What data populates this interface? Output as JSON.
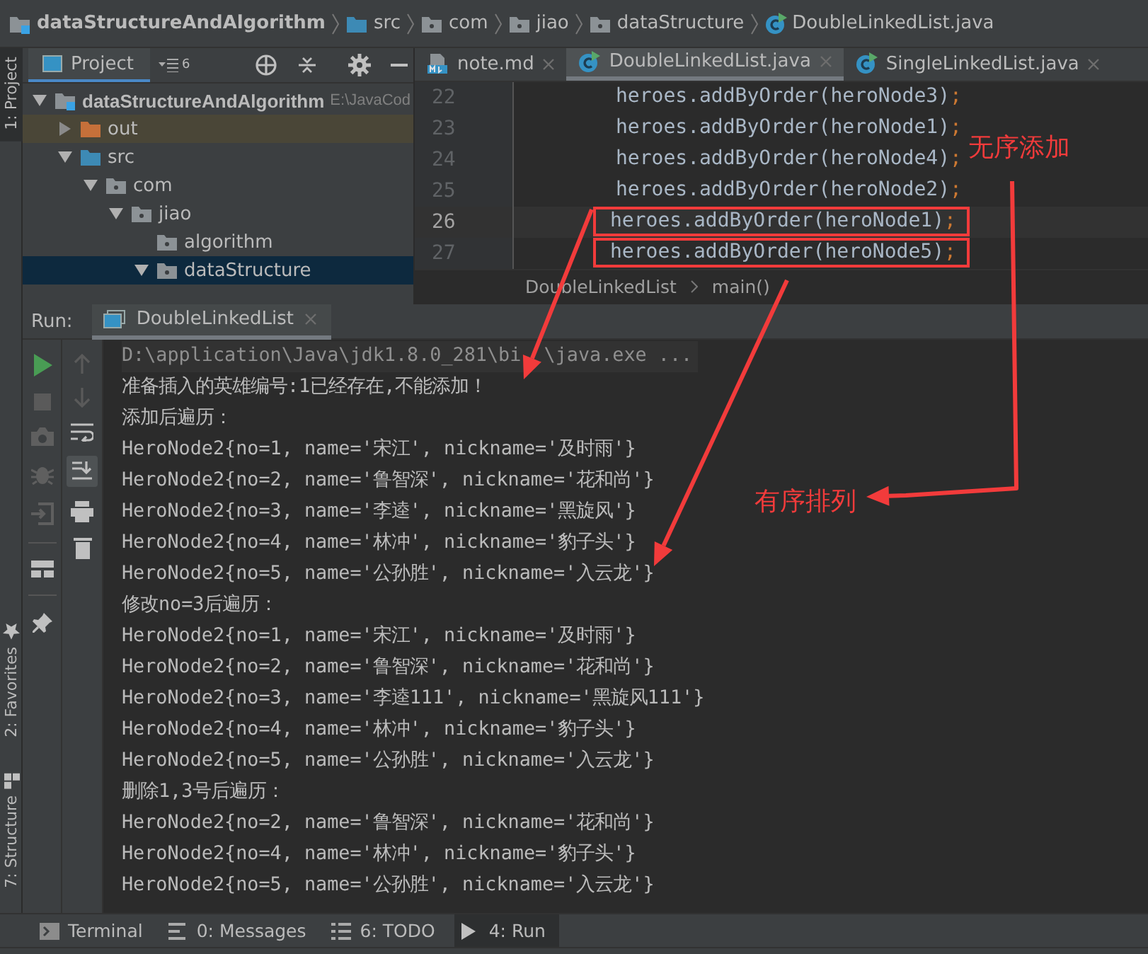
{
  "breadcrumbs": [
    {
      "label": "dataStructureAndAlgorithm",
      "kind": "module"
    },
    {
      "label": "src",
      "kind": "source"
    },
    {
      "label": "com",
      "kind": "package"
    },
    {
      "label": "jiao",
      "kind": "package"
    },
    {
      "label": "dataStructure",
      "kind": "package"
    },
    {
      "label": "DoubleLinkedList.java",
      "kind": "class"
    }
  ],
  "left_stripe": {
    "top": [
      {
        "label": "1: Project",
        "selected": true
      }
    ],
    "bottom": [
      {
        "label": "2: Favorites",
        "selected": false,
        "kind": "star"
      },
      {
        "label": "7: Structure",
        "selected": false,
        "kind": "structure"
      }
    ]
  },
  "project_panel": {
    "title": "Project",
    "count": "6",
    "tree": [
      {
        "label": "dataStructureAndAlgorithm",
        "path": "E:\\JavaCod",
        "kind": "module",
        "expanded": true,
        "selected": false,
        "children": [
          {
            "label": "out",
            "kind": "excluded",
            "expanded": false,
            "selected": false
          },
          {
            "label": "src",
            "kind": "source",
            "expanded": true,
            "selected": false,
            "children": [
              {
                "label": "com",
                "kind": "package",
                "expanded": true,
                "selected": false,
                "children": [
                  {
                    "label": "jiao",
                    "kind": "package",
                    "expanded": true,
                    "selected": false,
                    "children": [
                      {
                        "label": "algorithm",
                        "kind": "package",
                        "selected": false
                      },
                      {
                        "label": "dataStructure",
                        "kind": "package",
                        "expanded": true,
                        "selected": true
                      }
                    ]
                  }
                ]
              }
            ]
          }
        ]
      }
    ]
  },
  "editor": {
    "tabs": [
      {
        "label": "note.md",
        "kind": "markdown",
        "selected": false
      },
      {
        "label": "DoubleLinkedList.java",
        "kind": "class",
        "selected": true
      },
      {
        "label": "SingleLinkedList.java",
        "kind": "class",
        "selected": false
      }
    ],
    "lines": [
      {
        "number": "22",
        "code": "heroes.addByOrder(heroNode3)",
        "end": ";",
        "current": false,
        "boxed": false
      },
      {
        "number": "23",
        "code": "heroes.addByOrder(heroNode1)",
        "end": ";",
        "current": false,
        "boxed": false
      },
      {
        "number": "24",
        "code": "heroes.addByOrder(heroNode4)",
        "end": ";",
        "current": false,
        "boxed": false
      },
      {
        "number": "25",
        "code": "heroes.addByOrder(heroNode2)",
        "end": ";",
        "current": false,
        "boxed": false
      },
      {
        "number": "26",
        "code": "heroes.addByOrder(heroNode1)",
        "end": ";",
        "current": true,
        "boxed": true
      },
      {
        "number": "27",
        "code": "heroes.addByOrder(heroNode5)",
        "end": ";",
        "current": false,
        "boxed": true
      }
    ],
    "breadcrumbs": [
      "DoubleLinkedList",
      "main()"
    ]
  },
  "run": {
    "label": "Run:",
    "tab": "DoubleLinkedList",
    "lines": [
      {
        "kind": "command",
        "parts": [
          "D:\\application\\Java\\jdk1.8.0_281\\bi",
          "\\java.exe ..."
        ]
      },
      {
        "kind": "output",
        "text": "准备插入的英雄编号:1已经存在,不能添加！"
      },
      {
        "kind": "output",
        "text": "添加后遍历："
      },
      {
        "kind": "output",
        "text": "HeroNode2{no=1, name='宋江', nickname='及时雨'}"
      },
      {
        "kind": "output",
        "text": "HeroNode2{no=2, name='鲁智深', nickname='花和尚'}"
      },
      {
        "kind": "output",
        "text": "HeroNode2{no=3, name='李逵', nickname='黑旋风'}"
      },
      {
        "kind": "output",
        "text": "HeroNode2{no=4, name='林冲', nickname='豹子头'}"
      },
      {
        "kind": "output",
        "text": "HeroNode2{no=5, name='公孙胜', nickname='入云龙'}"
      },
      {
        "kind": "output",
        "text": "修改no=3后遍历："
      },
      {
        "kind": "output",
        "text": "HeroNode2{no=1, name='宋江', nickname='及时雨'}"
      },
      {
        "kind": "output",
        "text": "HeroNode2{no=2, name='鲁智深', nickname='花和尚'}"
      },
      {
        "kind": "output",
        "text": "HeroNode2{no=3, name='李逵111', nickname='黑旋风111'}"
      },
      {
        "kind": "output",
        "text": "HeroNode2{no=4, name='林冲', nickname='豹子头'}"
      },
      {
        "kind": "output",
        "text": "HeroNode2{no=5, name='公孙胜', nickname='入云龙'}"
      },
      {
        "kind": "output",
        "text": "删除1,3号后遍历："
      },
      {
        "kind": "output",
        "text": "HeroNode2{no=2, name='鲁智深', nickname='花和尚'}"
      },
      {
        "kind": "output",
        "text": "HeroNode2{no=4, name='林冲', nickname='豹子头'}"
      },
      {
        "kind": "output",
        "text": "HeroNode2{no=5, name='公孙胜', nickname='入云龙'}"
      }
    ]
  },
  "bottom_tabs": [
    {
      "label": "Terminal",
      "kind": "terminal",
      "selected": false
    },
    {
      "label": "0: Messages",
      "kind": "messages",
      "selected": false
    },
    {
      "label": "6: TODO",
      "kind": "todo",
      "selected": false
    },
    {
      "label": "4: Run",
      "kind": "run",
      "selected": true
    }
  ],
  "annotations": [
    {
      "text": "无序添加"
    },
    {
      "text": "有序排列"
    }
  ]
}
